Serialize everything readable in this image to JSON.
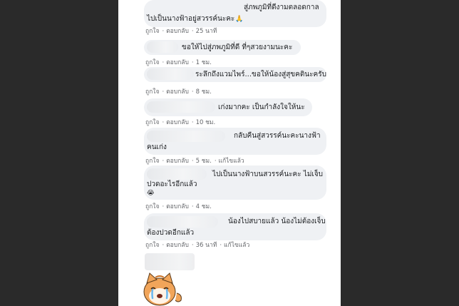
{
  "comments": [
    {
      "lines": [
        "สู่ภพภูมิที่ดีงามตลอดกาล",
        "ไปเป็นนางฟ้าอยู่สวรรค์นะคะ"
      ],
      "emoji": "🙏",
      "actions": {
        "like": "ถูกใจ",
        "reply": "ตอบกลับ",
        "time": "25 นาที",
        "edited": ""
      }
    },
    {
      "lines": [
        "ขอให้ไปสู่ภพภูมิที่ดี ที่ๆสวยงามนะคะ"
      ],
      "emoji": "",
      "actions": {
        "like": "ถูกใจ",
        "reply": "ตอบกลับ",
        "time": "1 ชม.",
        "edited": ""
      }
    },
    {
      "lines": [
        "ระลึกถึงแวมไพร์...ขอให้น้องสู่สุขคตินะครับ"
      ],
      "emoji": "",
      "actions": {
        "like": "ถูกใจ",
        "reply": "ตอบกลับ",
        "time": "8 ชม.",
        "edited": ""
      }
    },
    {
      "lines": [
        "เก่งมากคะ เป็นกำลังใจให้นะ"
      ],
      "emoji": "",
      "actions": {
        "like": "ถูกใจ",
        "reply": "ตอบกลับ",
        "time": "10 ชม.",
        "edited": ""
      }
    },
    {
      "lines": [
        "กลับคืนสู่สวรรค์นะคะนางฟ้า",
        "คนเก่ง"
      ],
      "emoji": "",
      "actions": {
        "like": "ถูกใจ",
        "reply": "ตอบกลับ",
        "time": "5 ชม.",
        "edited": "แก้ไขแล้ว"
      }
    },
    {
      "lines": [
        "ไปเป็นนางฟ้าบนสวรรค์นะคะ ไม่เจ็บ",
        "ปวดอะไรอีกแล้ว"
      ],
      "emoji": "😭",
      "actions": {
        "like": "ถูกใจ",
        "reply": "ตอบกลับ",
        "time": "4 ชม.",
        "edited": ""
      }
    },
    {
      "lines": [
        "น้องไปสบายแล้ว น้องไม่ต้องเจ็บ",
        "ต้องปวดอีกแล้ว"
      ],
      "emoji": "",
      "actions": {
        "like": "ถูกใจ",
        "reply": "ตอบกลับ",
        "time": "36 นาที",
        "edited": "แก้ไขแล้ว"
      }
    }
  ],
  "sticker": {
    "icon": "crying-cat-sticker"
  },
  "colors": {
    "bubble": "#eff1f4",
    "meta": "#65676b",
    "text": "#1c1e21",
    "background": "#2a2a2a"
  }
}
